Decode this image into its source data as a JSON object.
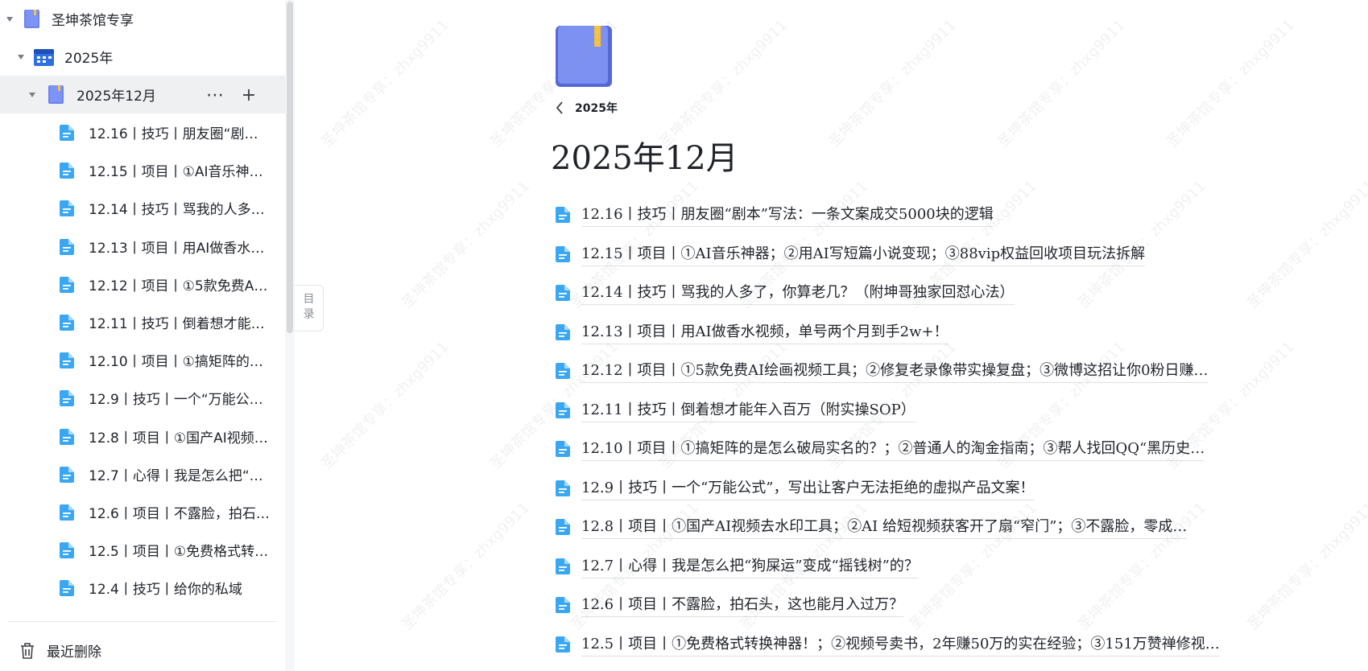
{
  "sidebar": {
    "root": {
      "label": "圣坤茶馆专享"
    },
    "year": {
      "label": "2025年"
    },
    "month": {
      "label": "2025年12月",
      "more": "⋯",
      "add": "+"
    },
    "docs": [
      "12.16丨技巧丨朋友圈“剧本”写法：一条文案成交5000块的逻辑",
      "12.15丨项目丨①AI音乐神器；②用AI写短篇小说变现；③88vip权益回收项目玩法拆解",
      "12.14丨技巧丨骂我的人多了，你算老几？（附坤哥独家回怼心法）",
      "12.13丨项目丨用AI做香水视频，单号两个月到手2w+！",
      "12.12丨项目丨①5款免费AI绘画视频工具",
      "12.11丨技巧丨倒着想才能年入百万",
      "12.10丨项目丨①搞矩阵的是怎么破局实名的？",
      "12.9丨技巧丨一个“万能公式”",
      "12.8丨项目丨①国产AI视频去水印工具",
      "12.7丨心得丨我是怎么把“狗屎运”变成“摇钱树”的？",
      "12.6丨项目丨不露脸，拍石头，这也能月入过万？",
      "12.5丨项目丨①免费格式转换神器！",
      "12.4丨技巧丨给你的私域"
    ],
    "recent_deleted": "最近删除",
    "toc_tab": "目录"
  },
  "main": {
    "back_label": "2025年",
    "title": "2025年12月",
    "docs": [
      "12.16丨技巧丨朋友圈“剧本”写法：一条文案成交5000块的逻辑",
      "12.15丨项目丨①AI音乐神器；②用AI写短篇小说变现；③88vip权益回收项目玩法拆解",
      "12.14丨技巧丨骂我的人多了，你算老几？（附坤哥独家回怼心法）",
      "12.13丨项目丨用AI做香水视频，单号两个月到手2w+！",
      "12.12丨项目丨①5款免费AI绘画视频工具；②修复老录像带实操复盘；③微博这招让你0粉日赚…",
      "12.11丨技巧丨倒着想才能年入百万（附实操SOP）",
      "12.10丨项目丨①搞矩阵的是怎么破局实名的？；②普通人的淘金指南；③帮人找回QQ“黑历史…",
      "12.9丨技巧丨一个“万能公式”，写出让客户无法拒绝的虚拟产品文案！",
      "12.8丨项目丨①国产AI视频去水印工具；②AI 给短视频获客开了扇“窄门”；③不露脸，零成…",
      "12.7丨心得丨我是怎么把“狗屎运”变成“摇钱树”的？",
      "12.6丨项目丨不露脸，拍石头，这也能月入过万？",
      "12.5丨项目丨①免费格式转换神器！；②视频号卖书，2年赚50万的实在经验；③151万赞禅修视…"
    ]
  },
  "watermark": "圣坤茶馆专享：zhxg9911",
  "colors": {
    "doc_icon": "#3aa7f5",
    "book_icon": "#6b83f0",
    "bookmark": "#f5c242",
    "selected_row": "#eff0f2"
  }
}
